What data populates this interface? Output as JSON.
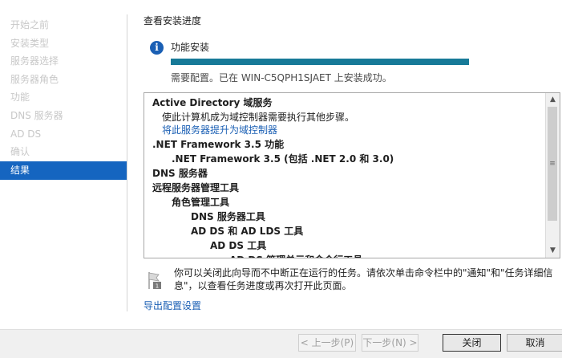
{
  "nav": {
    "items": [
      {
        "label": "开始之前"
      },
      {
        "label": "安装类型"
      },
      {
        "label": "服务器选择"
      },
      {
        "label": "服务器角色"
      },
      {
        "label": "功能"
      },
      {
        "label": "DNS 服务器"
      },
      {
        "label": "AD DS"
      },
      {
        "label": "确认"
      },
      {
        "label": "结果"
      }
    ],
    "active_index": 8
  },
  "main": {
    "title": "查看安装进度",
    "feature_label": "功能安装",
    "progress_fraction": 1.0,
    "status": "需要配置。已在 WIN-C5QPH1SJAET 上安装成功。",
    "results": [
      {
        "text": "Active Directory 域服务",
        "style": "bold",
        "indent": 0
      },
      {
        "text": "使此计算机成为域控制器需要执行其他步骤。",
        "style": "normal",
        "indent": 1
      },
      {
        "text": "将此服务器提升为域控制器",
        "style": "link",
        "indent": 1
      },
      {
        "text": ".NET Framework 3.5 功能",
        "style": "bold",
        "indent": 0
      },
      {
        "text": ".NET Framework 3.5 (包括 .NET 2.0 和 3.0)",
        "style": "bold",
        "indent": 2
      },
      {
        "text": "DNS 服务器",
        "style": "bold",
        "indent": 0
      },
      {
        "text": "远程服务器管理工具",
        "style": "bold",
        "indent": 0
      },
      {
        "text": "角色管理工具",
        "style": "bold",
        "indent": 2
      },
      {
        "text": "DNS 服务器工具",
        "style": "bold",
        "indent": 4
      },
      {
        "text": "AD DS 和 AD LDS 工具",
        "style": "bold",
        "indent": 4
      },
      {
        "text": "AD DS 工具",
        "style": "bold",
        "indent": 6
      },
      {
        "text": "AD DS 管理单元和命令行工具",
        "style": "bold",
        "indent": 8
      }
    ],
    "notice": "你可以关闭此向导而不中断正在运行的任务。请依次单击命令栏中的\"通知\"和\"任务详细信息\"，以查看任务进度或再次打开此页面。",
    "export_link": "导出配置设置"
  },
  "footer": {
    "prev": "< 上一步(P)",
    "next": "下一步(N) >",
    "close": "关闭",
    "cancel": "取消"
  },
  "colors": {
    "accent": "#1565c0",
    "progress": "#177a98",
    "link": "#1a5fb4"
  },
  "icons": {
    "info": "info-icon",
    "flag": "flag-icon",
    "scroll_up": "chevron-up-icon",
    "scroll_down": "chevron-down-icon"
  }
}
